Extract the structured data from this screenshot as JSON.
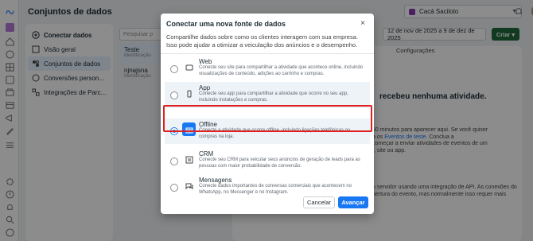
{
  "header": {
    "title": "Conjuntos de dados",
    "account_name": "Cacá Saciloto",
    "create_label": "Criar",
    "date_range": "12 de nov de 2025 a 9 de dez de 2025"
  },
  "rail": {
    "icons": [
      "meta-logo-icon",
      "home-icon",
      "ads-icon",
      "grid-icon",
      "chart-icon",
      "pages-icon",
      "catalog-icon",
      "billing-icon",
      "people-icon",
      "announce-icon",
      "pencil-icon",
      "menu-icon",
      "settings-icon",
      "alert-icon",
      "bell-icon",
      "search-icon",
      "help-icon"
    ]
  },
  "nav": {
    "items": [
      {
        "label": "Conectar dados",
        "icon": "plus-circle-icon"
      },
      {
        "label": "Visão geral",
        "icon": "overview-icon"
      },
      {
        "label": "Conjuntos de dados",
        "icon": "datasets-icon"
      },
      {
        "label": "Conversões person...",
        "icon": "conversions-icon"
      },
      {
        "label": "Integrações de Parc...",
        "icon": "integrations-icon"
      }
    ]
  },
  "list": {
    "search_placeholder": "Pesquisar p",
    "items": [
      {
        "name": "Teste",
        "sub": "Identificação"
      },
      {
        "name": "njnajsna",
        "sub": "Identificação"
      }
    ]
  },
  "background": {
    "tab_history": "...",
    "tab_settings": "Configurações",
    "no_activity": "recebeu nenhuma atividade.",
    "para1_a": "50 minutos para aparecer aqui. Se você quiser",
    "para1_b": "a os ",
    "para1_link": "Eventos de teste",
    "para1_c": ". Conclua a",
    "para1_d": "começar a enviar atividades de eventos de um",
    "para1_e": "t, site ou app.",
    "para2_a": "u servidor usando uma integração de API. As conexões do",
    "para2_b": "bertura do evento, mas normalmente isso requer mais"
  },
  "modal": {
    "title": "Conectar uma nova fonte de dados",
    "description": "Compartilhe dados sobre como os clientes interagem com sua empresa. Isso pode ajudar a otimizar a veiculação dos anúncios e o desempenho.",
    "options": [
      {
        "title": "Web",
        "description": "Conecte seu site para compartilhar a atividade que acontece online, incluindo visualizações de conteúdo, adições ao carrinho e compras.",
        "icon": "web-icon",
        "selected": false
      },
      {
        "title": "App",
        "description": "Conecte seu app para compartilhar a atividade que ocorre no seu app, incluindo instalações e compras.",
        "icon": "app-icon",
        "selected": false
      },
      {
        "title": "Offline",
        "description": "Conecte a atividade que ocorre offline, incluindo ligações telefônicas ou compras na loja.",
        "icon": "store-icon",
        "selected": true
      },
      {
        "title": "CRM",
        "description": "Conecte seu CRM para veicular seus anúncios de geração de leads para as pessoas com maior probabilidade de conversão.",
        "icon": "crm-icon",
        "selected": false
      },
      {
        "title": "Mensagens",
        "description": "Conecte dados importantes de conversas comerciais que acontecem no WhatsApp, no Messenger e no Instagram.",
        "icon": "messages-icon",
        "selected": false
      }
    ],
    "cancel_label": "Cancelar",
    "next_label": "Avançar",
    "close_label": "×"
  }
}
